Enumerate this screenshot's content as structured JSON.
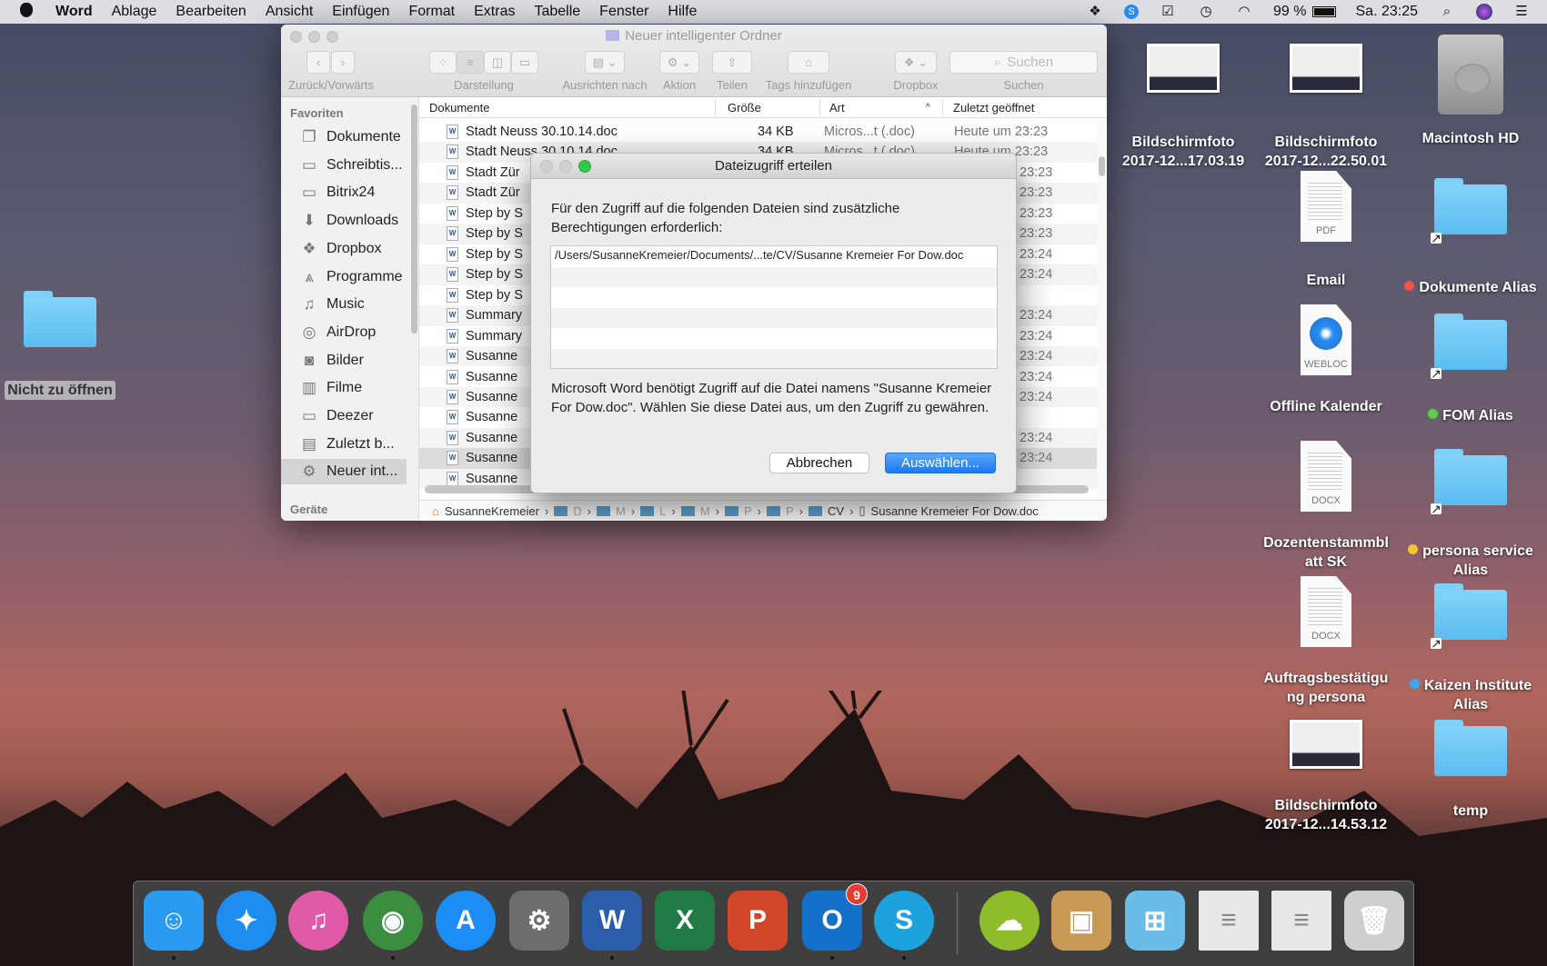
{
  "menubar": {
    "app": "Word",
    "items": [
      "Ablage",
      "Bearbeiten",
      "Ansicht",
      "Einfügen",
      "Format",
      "Extras",
      "Tabelle",
      "Fenster",
      "Hilfe"
    ],
    "battery": "99 %",
    "clock": "Sa. 23:25"
  },
  "finder": {
    "title": "Neuer intelligenter Ordner",
    "toolbar": {
      "nav": "Zurück/Vorwärts",
      "view": "Darstellung",
      "arrange": "Ausrichten nach",
      "action": "Aktion",
      "share": "Teilen",
      "tags": "Tags hinzufügen",
      "dropbox": "Dropbox",
      "search_label": "Suchen",
      "search_placeholder": "Suchen"
    },
    "sidebar": {
      "favorites": "Favoriten",
      "devices": "Geräte",
      "items": [
        {
          "label": "Dokumente",
          "icon": "documents-icon"
        },
        {
          "label": "Schreibtis...",
          "icon": "desktop-icon"
        },
        {
          "label": "Bitrix24",
          "icon": "folder-icon"
        },
        {
          "label": "Downloads",
          "icon": "downloads-icon"
        },
        {
          "label": "Dropbox",
          "icon": "dropbox-icon"
        },
        {
          "label": "Programme",
          "icon": "applications-icon"
        },
        {
          "label": "Music",
          "icon": "music-icon"
        },
        {
          "label": "AirDrop",
          "icon": "airdrop-icon"
        },
        {
          "label": "Bilder",
          "icon": "camera-icon"
        },
        {
          "label": "Filme",
          "icon": "film-icon"
        },
        {
          "label": "Deezer",
          "icon": "folder-icon"
        },
        {
          "label": "Zuletzt b...",
          "icon": "recents-icon"
        },
        {
          "label": "Neuer int...",
          "icon": "gear-icon"
        }
      ]
    },
    "columns": {
      "name": "Dokumente",
      "size": "Größe",
      "kind": "Art",
      "opened": "Zuletzt geöffnet"
    },
    "rows": [
      {
        "name": "Stadt Neuss 30.10.14.doc",
        "size": "34 KB",
        "kind": "Micros...t (.doc)",
        "opened": "Heute um 23:23"
      },
      {
        "name": "Stadt Neuss 30.10.14.doc",
        "size": "34 KB",
        "kind": "Micros...t (.doc)",
        "opened": "Heute um 23:23"
      },
      {
        "name": "Stadt Zür",
        "opened_tail": "23:23"
      },
      {
        "name": "Stadt Zür",
        "opened_tail": "23:23"
      },
      {
        "name": "Step by S",
        "opened_tail": "23:23"
      },
      {
        "name": "Step by S",
        "opened_tail": "23:23"
      },
      {
        "name": "Step by S",
        "opened_tail": "23:24"
      },
      {
        "name": "Step by S",
        "opened_tail": "23:24"
      },
      {
        "name": "Step by S"
      },
      {
        "name": "Summary",
        "opened_tail": "23:24"
      },
      {
        "name": "Summary",
        "opened_tail": "23:24"
      },
      {
        "name": "Susanne",
        "opened_tail": "23:24"
      },
      {
        "name": "Susanne",
        "opened_tail": "23:24"
      },
      {
        "name": "Susanne",
        "opened_tail": "23:24"
      },
      {
        "name": "Susanne"
      },
      {
        "name": "Susanne",
        "opened_tail": "23:24"
      },
      {
        "name": "Susanne",
        "opened_tail": "23:24",
        "selected": true
      },
      {
        "name": "Susanne"
      }
    ],
    "path": {
      "home": "SusanneKremeier",
      "folders": [
        "D",
        "M",
        "L",
        "M",
        "P",
        "P",
        "CV"
      ],
      "file": "Susanne Kremeier For Dow.doc"
    }
  },
  "dialog": {
    "title": "Dateizugriff erteilen",
    "intro": "Für den Zugriff auf die folgenden Dateien sind zusätzliche Berechtigungen erforderlich:",
    "files": [
      "/Users/SusanneKremeier/Documents/...te/CV/Susanne Kremeier For Dow.doc"
    ],
    "message": "Microsoft Word benötigt Zugriff auf die Datei namens \"Susanne Kremeier For Dow.doc\". Wählen Sie diese Datei aus, um den Zugriff zu gewähren.",
    "cancel": "Abbrechen",
    "confirm": "Auswählen..."
  },
  "desktop": [
    {
      "label": "Nicht zu öffnen",
      "type": "folder"
    },
    {
      "label": "Bildschirmfoto 2017-12...17.03.19",
      "type": "screenshot"
    },
    {
      "label": "Bildschirmfoto 2017-12...22.50.01",
      "type": "screenshot"
    },
    {
      "label": "Macintosh HD",
      "type": "disk"
    },
    {
      "label": "Email",
      "type": "doc",
      "ext": "PDF"
    },
    {
      "label": "Dokumente Alias",
      "type": "alias",
      "tag": "#f0524f"
    },
    {
      "label": "Offline Kalender",
      "type": "doc",
      "ext": "WEBLOC"
    },
    {
      "label": "FOM Alias",
      "type": "alias",
      "tag": "#5ccc4a"
    },
    {
      "label": "Dozentenstammbl att SK",
      "type": "doc",
      "ext": "DOCX"
    },
    {
      "label": "persona service Alias",
      "type": "alias",
      "tag": "#f5c62c"
    },
    {
      "label": "Auftragsbestätigu ng persona",
      "type": "doc",
      "ext": "DOCX"
    },
    {
      "label": "Kaizen Institute Alias",
      "type": "alias",
      "tag": "#3aa8f0"
    },
    {
      "label": "Bildschirmfoto 2017-12...14.53.12",
      "type": "screenshot"
    },
    {
      "label": "temp",
      "type": "folder"
    }
  ],
  "dock": [
    {
      "name": "finder",
      "glyph": "☺",
      "color": "#2a9bf0",
      "running": true
    },
    {
      "name": "safari",
      "glyph": "✦",
      "color": "#1d8ef0",
      "running": false
    },
    {
      "name": "itunes",
      "glyph": "♫",
      "color": "#e05aa8",
      "running": false
    },
    {
      "name": "chrome",
      "glyph": "◉",
      "color": "#3b8d3f",
      "running": true
    },
    {
      "name": "app-store",
      "glyph": "A",
      "color": "#1c8df5",
      "running": false
    },
    {
      "name": "system-preferences",
      "glyph": "⚙",
      "color": "#6d6d6d",
      "running": false
    },
    {
      "name": "word",
      "glyph": "W",
      "color": "#2b5eaa",
      "running": true
    },
    {
      "name": "excel",
      "glyph": "X",
      "color": "#1f7a44",
      "running": false
    },
    {
      "name": "powerpoint",
      "glyph": "P",
      "color": "#d2472a",
      "running": false
    },
    {
      "name": "outlook",
      "glyph": "O",
      "color": "#1570c9",
      "running": true,
      "badge": "9"
    },
    {
      "name": "skype",
      "glyph": "S",
      "color": "#1ea2de",
      "running": true
    },
    {
      "name": "cloud-app",
      "glyph": "☁",
      "color": "#8ebd2c",
      "running": false
    },
    {
      "name": "installer",
      "glyph": "▣",
      "color": "#c99a55",
      "running": false
    },
    {
      "name": "windows-folder",
      "glyph": "⊞",
      "color": "#6bbde9",
      "running": false
    },
    {
      "name": "outlook-document",
      "glyph": "≡",
      "color": "#e8e8e8",
      "running": false
    },
    {
      "name": "chrome-document",
      "glyph": "≡",
      "color": "#e8e8e8",
      "running": false
    },
    {
      "name": "trash",
      "glyph": "🗑",
      "color": "#cfcfcf",
      "running": false
    }
  ]
}
